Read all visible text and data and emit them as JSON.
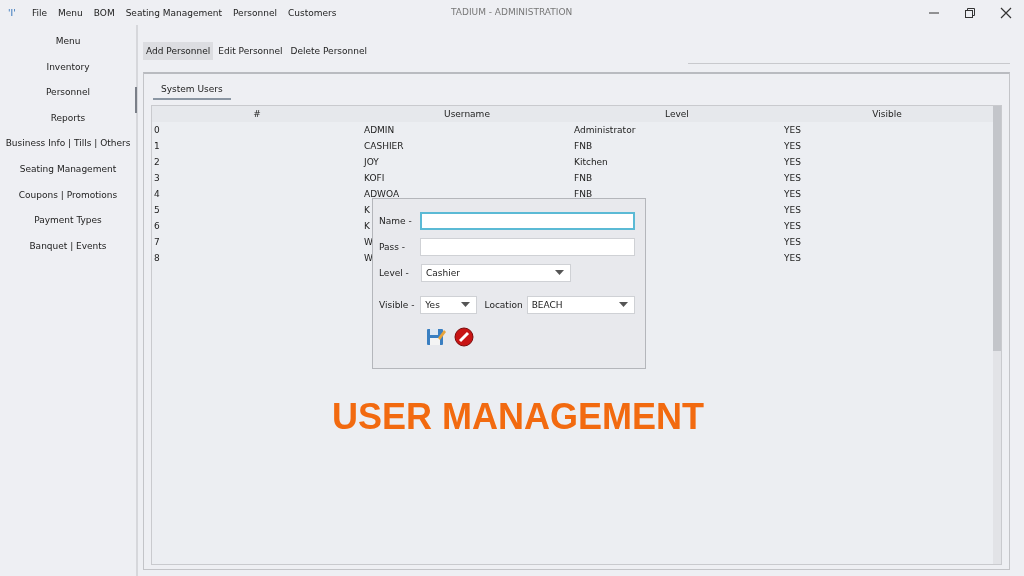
{
  "window": {
    "logo": "'I'",
    "title": "TADIUM -  ADMINISTRATION"
  },
  "menu_bar": [
    "File",
    "Menu",
    "BOM",
    "Seating Management",
    "Personnel",
    "Customers"
  ],
  "sidebar": {
    "items": [
      {
        "label": "Menu",
        "selected": false
      },
      {
        "label": "Inventory",
        "selected": false
      },
      {
        "label": "Personnel",
        "selected": true
      },
      {
        "label": "Reports",
        "selected": false
      },
      {
        "label": "Business Info | Tills | Others",
        "selected": false
      },
      {
        "label": "Seating Management",
        "selected": false
      },
      {
        "label": "Coupons | Promotions",
        "selected": false
      },
      {
        "label": "Payment Types",
        "selected": false
      },
      {
        "label": "Banquet | Events",
        "selected": false
      }
    ]
  },
  "toolbar": [
    {
      "label": "Add Personnel",
      "selected": true
    },
    {
      "label": "Edit Personnel",
      "selected": false
    },
    {
      "label": "Delete Personnel",
      "selected": false
    }
  ],
  "tabs": [
    {
      "label": "System Users",
      "selected": true
    }
  ],
  "table": {
    "columns": [
      "#",
      "Username",
      "Level",
      "Visible"
    ],
    "rows": [
      {
        "num": "0",
        "username": "ADMIN",
        "level": "Administrator",
        "visible": "YES"
      },
      {
        "num": "1",
        "username": "CASHIER",
        "level": "FNB",
        "visible": "YES"
      },
      {
        "num": "2",
        "username": "JOY",
        "level": "Kitchen",
        "visible": "YES"
      },
      {
        "num": "3",
        "username": "KOFI",
        "level": "FNB",
        "visible": "YES"
      },
      {
        "num": "4",
        "username": "ADWOA",
        "level": "FNB",
        "visible": "YES"
      },
      {
        "num": "5",
        "username": "K",
        "visible": "YES"
      },
      {
        "num": "6",
        "username": "K",
        "visible": "YES"
      },
      {
        "num": "7",
        "username": "W",
        "visible": "YES"
      },
      {
        "num": "8",
        "username": "W",
        "visible": "YES"
      }
    ]
  },
  "dialog": {
    "name_label": "Name -",
    "pass_label": "Pass -",
    "level_label": "Level -",
    "level_value": "Cashier",
    "visible_label": "Visible -",
    "visible_value": "Yes",
    "location_label": "Location",
    "location_value": "BEACH"
  },
  "overlay_title": "USER MANAGEMENT"
}
